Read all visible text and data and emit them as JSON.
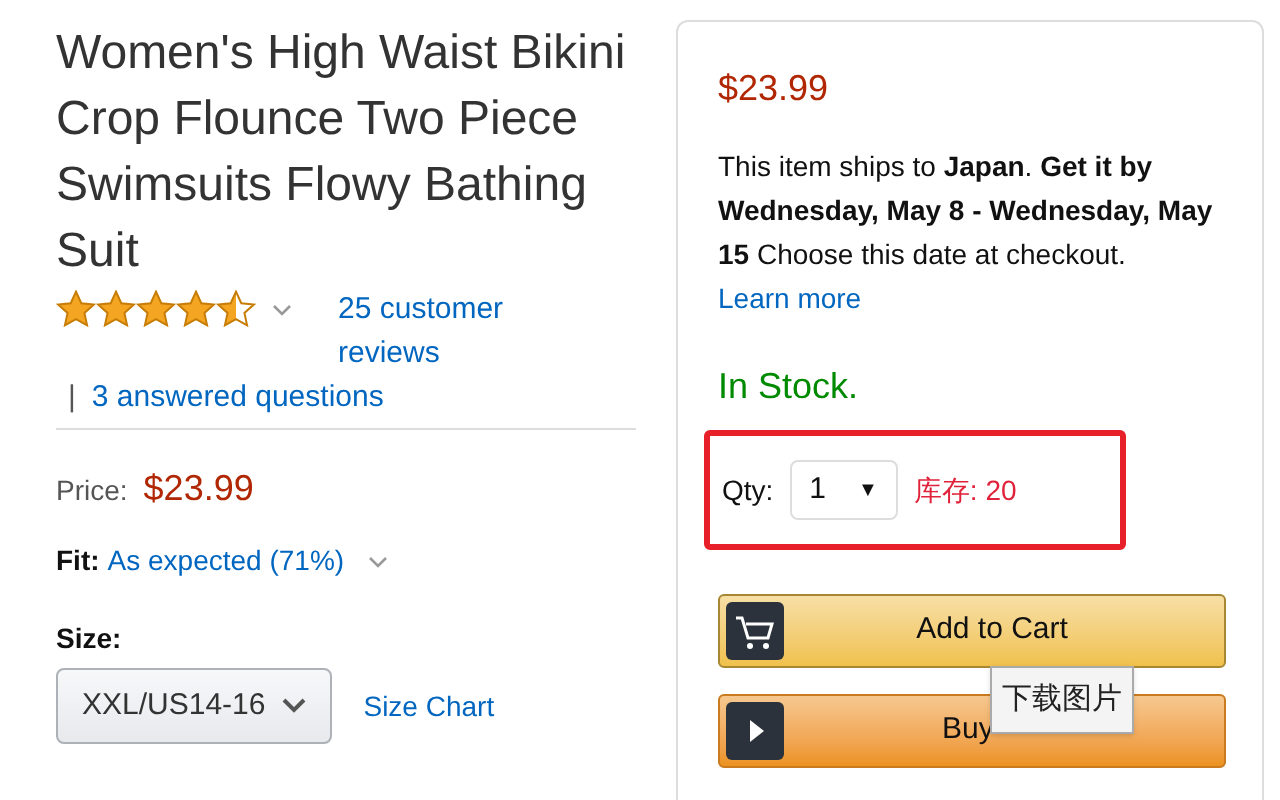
{
  "product": {
    "title": "Women's High Waist Bikini Crop Flounce Two Piece Swimsuits Flowy Bathing Suit",
    "stars": 4.5,
    "reviews_link": "25 customer reviews",
    "separator": "|",
    "questions_link": "3 answered questions",
    "price_label": "Price:",
    "price": "$23.99",
    "fit_label": "Fit:",
    "fit_value": "As expected (71%)",
    "size_label": "Size:",
    "size_value": "XXL/US14-16",
    "size_chart": "Size Chart"
  },
  "buy_box": {
    "price": "$23.99",
    "shipping": "This item ships to **Japan**. **Get it by Wednesday, May 8 - Wednesday, May 15** Choose this date at checkout.",
    "learn_more": "Learn more",
    "stock": "In Stock.",
    "qty_label": "Qty:",
    "qty_value": "1",
    "qty_arrow": "▼",
    "inventory": "库存: 20",
    "add_to_cart": "Add to Cart",
    "buy_now": "Buy",
    "tooltip": "下载图片"
  }
}
